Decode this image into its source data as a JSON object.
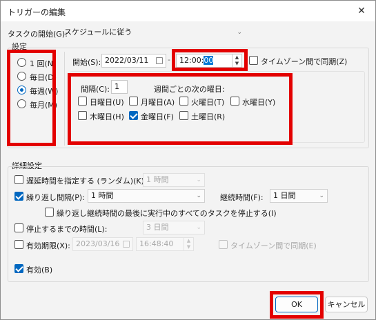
{
  "window": {
    "title": "トリガーの編集",
    "close_glyph": "✕"
  },
  "start_task": {
    "label": "タスクの開始(G):",
    "value": "スケジュールに従う"
  },
  "settings": {
    "title": "設定",
    "frequency": [
      {
        "label": "1 回(N)",
        "selected": false
      },
      {
        "label": "毎日(D)",
        "selected": false
      },
      {
        "label": "毎週(W)",
        "selected": true
      },
      {
        "label": "毎月(M)",
        "selected": false
      }
    ],
    "start_label": "開始(S):",
    "start_date": "2022/03/11",
    "start_time_prefix": "12:00:",
    "start_time_selected": "00",
    "sync_timezone_label": "タイムゾーン間で同期(Z)",
    "interval_label": "間隔(C):",
    "interval_value": "1",
    "weekday_caption": "週間ごとの次の曜日:",
    "weekdays": [
      {
        "label": "日曜日(U)",
        "checked": false
      },
      {
        "label": "月曜日(A)",
        "checked": false
      },
      {
        "label": "火曜日(T)",
        "checked": false
      },
      {
        "label": "水曜日(Y)",
        "checked": false
      },
      {
        "label": "木曜日(H)",
        "checked": false
      },
      {
        "label": "金曜日(F)",
        "checked": true
      },
      {
        "label": "土曜日(R)",
        "checked": false
      }
    ]
  },
  "advanced": {
    "title": "詳細設定",
    "delay_label": "遅延時間を指定する (ランダム)(K):",
    "delay_value": "1 時間",
    "repeat_label": "繰り返し間隔(P):",
    "repeat_value": "1 時間",
    "duration_label": "継続時間(F):",
    "duration_value": "1 日間",
    "stop_all_label": "繰り返し継続時間の最後に実行中のすべてのタスクを停止する(I)",
    "stop_after_label": "停止するまでの時間(L):",
    "stop_after_value": "3 日間",
    "expire_label": "有効期限(X):",
    "expire_date": "2023/03/16",
    "expire_time": "16:48:40",
    "expire_sync_label": "タイムゾーン間で同期(E)",
    "enabled_label": "有効(B)"
  },
  "buttons": {
    "ok": "OK",
    "cancel": "キャンセル"
  },
  "colors": {
    "accent": "#0067c0",
    "highlight": "#e30000"
  }
}
